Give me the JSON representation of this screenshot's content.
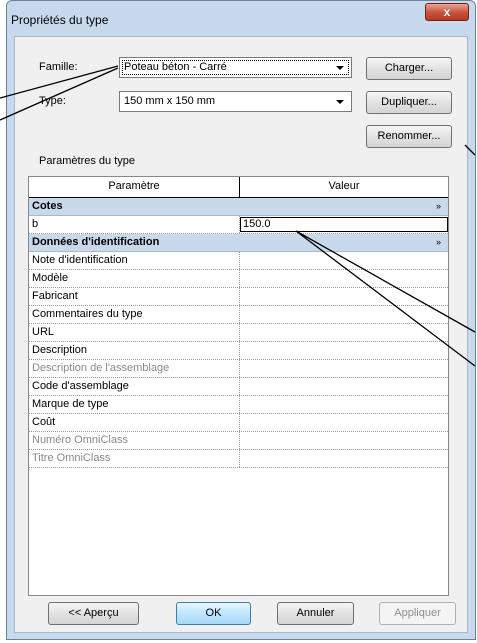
{
  "window": {
    "title": "Propriétés du type",
    "close_glyph": "x"
  },
  "famille": {
    "label": "Famille:",
    "value": "Poteau béton - Carré"
  },
  "type": {
    "label": "Type:",
    "value": "150 mm x 150 mm"
  },
  "buttons": {
    "charger": "Charger...",
    "dupliquer": "Dupliquer...",
    "renommer": "Renommer...",
    "apercu": "<< Aperçu",
    "ok": "OK",
    "annuler": "Annuler",
    "appliquer": "Appliquer"
  },
  "section_label": "Paramètres du type",
  "grid": {
    "header": {
      "param": "Paramètre",
      "value": "Valeur"
    },
    "groups": [
      {
        "name": "Cotes",
        "chevron": "»",
        "rows": [
          {
            "param": "b",
            "value": "150.0",
            "editing": true
          }
        ]
      },
      {
        "name": "Données d'identification",
        "chevron": "»",
        "rows": [
          {
            "param": "Note d'identification",
            "value": ""
          },
          {
            "param": "Modèle",
            "value": ""
          },
          {
            "param": "Fabricant",
            "value": ""
          },
          {
            "param": "Commentaires du type",
            "value": ""
          },
          {
            "param": "URL",
            "value": ""
          },
          {
            "param": "Description",
            "value": ""
          },
          {
            "param": "Description de l'assemblage",
            "value": "",
            "greyed": true
          },
          {
            "param": "Code d'assemblage",
            "value": ""
          },
          {
            "param": "Marque de type",
            "value": ""
          },
          {
            "param": "Coût",
            "value": ""
          },
          {
            "param": "Numéro OmniClass",
            "value": "",
            "greyed": true
          },
          {
            "param": "Titre OmniClass",
            "value": "",
            "greyed": true
          }
        ]
      }
    ]
  }
}
